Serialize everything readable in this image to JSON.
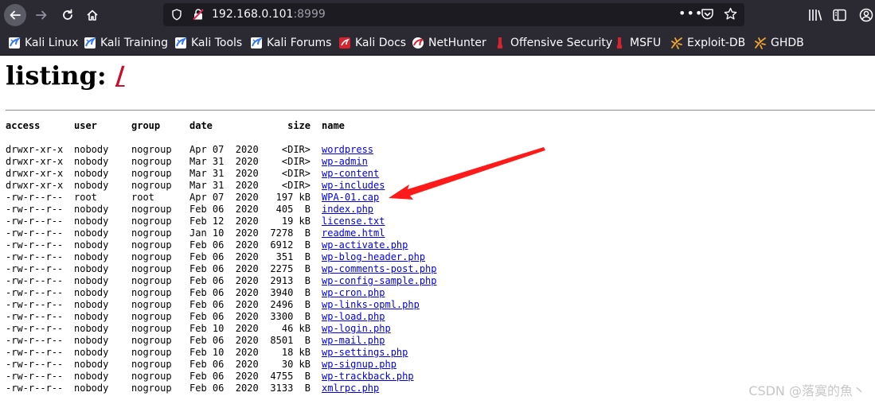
{
  "browser": {
    "url_host": "192.168.0.101",
    "url_port": ":8999",
    "bookmarks": [
      {
        "label": "Kali Linux",
        "icon": "kali-dragon-icon"
      },
      {
        "label": "Kali Training",
        "icon": "kali-dragon-icon"
      },
      {
        "label": "Kali Tools",
        "icon": "kali-dragon-icon"
      },
      {
        "label": "Kali Forums",
        "icon": "kali-dragon-icon"
      },
      {
        "label": "Kali Docs",
        "icon": "kali-docs-icon"
      },
      {
        "label": "NetHunter",
        "icon": "nethunter-icon"
      },
      {
        "label": "Offensive Security",
        "icon": "offsec-icon"
      },
      {
        "label": "MSFU",
        "icon": "offsec-icon"
      },
      {
        "label": "Exploit-DB",
        "icon": "exploitdb-icon"
      },
      {
        "label": "GHDB",
        "icon": "exploitdb-icon"
      }
    ]
  },
  "page": {
    "title_prefix": "listing:",
    "title_path": "/",
    "columns": {
      "access": "access",
      "user": "user",
      "group": "group",
      "date": "date",
      "size": "size",
      "name": "name"
    },
    "rows": [
      {
        "access": "drwxr-xr-x",
        "user": "nobody",
        "group": "nogroup",
        "date": "Apr 07  2020",
        "size": "<DIR>",
        "name": "wordpress"
      },
      {
        "access": "drwxr-xr-x",
        "user": "nobody",
        "group": "nogroup",
        "date": "Mar 31  2020",
        "size": "<DIR>",
        "name": "wp-admin"
      },
      {
        "access": "drwxr-xr-x",
        "user": "nobody",
        "group": "nogroup",
        "date": "Mar 31  2020",
        "size": "<DIR>",
        "name": "wp-content"
      },
      {
        "access": "drwxr-xr-x",
        "user": "nobody",
        "group": "nogroup",
        "date": "Mar 31  2020",
        "size": "<DIR>",
        "name": "wp-includes"
      },
      {
        "access": "-rw-r--r--",
        "user": "root",
        "group": "root",
        "date": "Apr 07  2020",
        "size": "197 kB",
        "name": "WPA-01.cap"
      },
      {
        "access": "-rw-r--r--",
        "user": "nobody",
        "group": "nogroup",
        "date": "Feb 06  2020",
        "size": "405  B",
        "name": "index.php"
      },
      {
        "access": "-rw-r--r--",
        "user": "nobody",
        "group": "nogroup",
        "date": "Feb 12  2020",
        "size": "19 kB",
        "name": "license.txt"
      },
      {
        "access": "-rw-r--r--",
        "user": "nobody",
        "group": "nogroup",
        "date": "Jan 10  2020",
        "size": "7278  B",
        "name": "readme.html"
      },
      {
        "access": "-rw-r--r--",
        "user": "nobody",
        "group": "nogroup",
        "date": "Feb 06  2020",
        "size": "6912  B",
        "name": "wp-activate.php"
      },
      {
        "access": "-rw-r--r--",
        "user": "nobody",
        "group": "nogroup",
        "date": "Feb 06  2020",
        "size": "351  B",
        "name": "wp-blog-header.php"
      },
      {
        "access": "-rw-r--r--",
        "user": "nobody",
        "group": "nogroup",
        "date": "Feb 06  2020",
        "size": "2275  B",
        "name": "wp-comments-post.php"
      },
      {
        "access": "-rw-r--r--",
        "user": "nobody",
        "group": "nogroup",
        "date": "Feb 06  2020",
        "size": "2913  B",
        "name": "wp-config-sample.php"
      },
      {
        "access": "-rw-r--r--",
        "user": "nobody",
        "group": "nogroup",
        "date": "Feb 06  2020",
        "size": "3940  B",
        "name": "wp-cron.php"
      },
      {
        "access": "-rw-r--r--",
        "user": "nobody",
        "group": "nogroup",
        "date": "Feb 06  2020",
        "size": "2496  B",
        "name": "wp-links-opml.php"
      },
      {
        "access": "-rw-r--r--",
        "user": "nobody",
        "group": "nogroup",
        "date": "Feb 06  2020",
        "size": "3300  B",
        "name": "wp-load.php"
      },
      {
        "access": "-rw-r--r--",
        "user": "nobody",
        "group": "nogroup",
        "date": "Feb 10  2020",
        "size": "46 kB",
        "name": "wp-login.php"
      },
      {
        "access": "-rw-r--r--",
        "user": "nobody",
        "group": "nogroup",
        "date": "Feb 06  2020",
        "size": "8501  B",
        "name": "wp-mail.php"
      },
      {
        "access": "-rw-r--r--",
        "user": "nobody",
        "group": "nogroup",
        "date": "Feb 10  2020",
        "size": "18 kB",
        "name": "wp-settings.php"
      },
      {
        "access": "-rw-r--r--",
        "user": "nobody",
        "group": "nogroup",
        "date": "Feb 06  2020",
        "size": "30 kB",
        "name": "wp-signup.php"
      },
      {
        "access": "-rw-r--r--",
        "user": "nobody",
        "group": "nogroup",
        "date": "Feb 06  2020",
        "size": "4755  B",
        "name": "wp-trackback.php"
      },
      {
        "access": "-rw-r--r--",
        "user": "nobody",
        "group": "nogroup",
        "date": "Feb 06  2020",
        "size": "3133  B",
        "name": "xmlrpc.php"
      }
    ]
  },
  "annotation": {
    "color": "#ff1a1a"
  },
  "watermark": "CSDN @落寞的魚丶"
}
